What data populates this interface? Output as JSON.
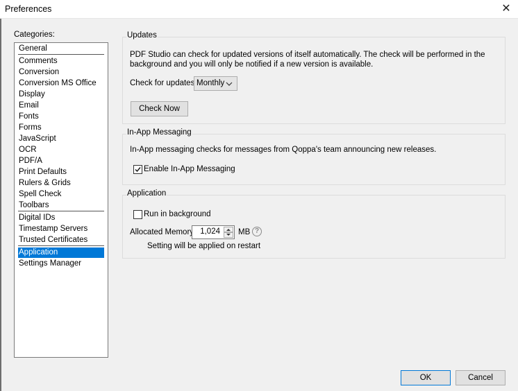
{
  "window": {
    "title": "Preferences"
  },
  "sidebar": {
    "label": "Categories:",
    "items": [
      "General",
      "Comments",
      "Conversion",
      "Conversion MS Office",
      "Display",
      "Email",
      "Fonts",
      "Forms",
      "JavaScript",
      "OCR",
      "PDF/A",
      "Print Defaults",
      "Rulers & Grids",
      "Spell Check",
      "Toolbars",
      "Digital IDs",
      "Timestamp Servers",
      "Trusted Certificates",
      "Application",
      "Settings Manager"
    ],
    "selected": "Application"
  },
  "updates": {
    "title": "Updates",
    "desc_line1": "PDF Studio can check for updated versions of itself automatically. The check will be performed in the",
    "desc_line2": "background and you will only be notified if a new version is available.",
    "check_label": "Check for updates",
    "frequency": "Monthly",
    "check_now": "Check Now"
  },
  "messaging": {
    "title": "In-App Messaging",
    "desc": "In-App messaging checks for messages from Qoppa's team announcing new releases.",
    "enable_label": "Enable In-App Messaging",
    "enable_checked": true
  },
  "application": {
    "title": "Application",
    "run_bg_label": "Run in background",
    "run_bg_checked": false,
    "memory_label": "Allocated Memory",
    "memory_value": "1,024",
    "memory_unit": "MB",
    "help_glyph": "?",
    "restart_note": "Setting will be applied on restart"
  },
  "footer": {
    "ok": "OK",
    "cancel": "Cancel"
  },
  "icons": {
    "close": "✕",
    "check": "✓"
  }
}
